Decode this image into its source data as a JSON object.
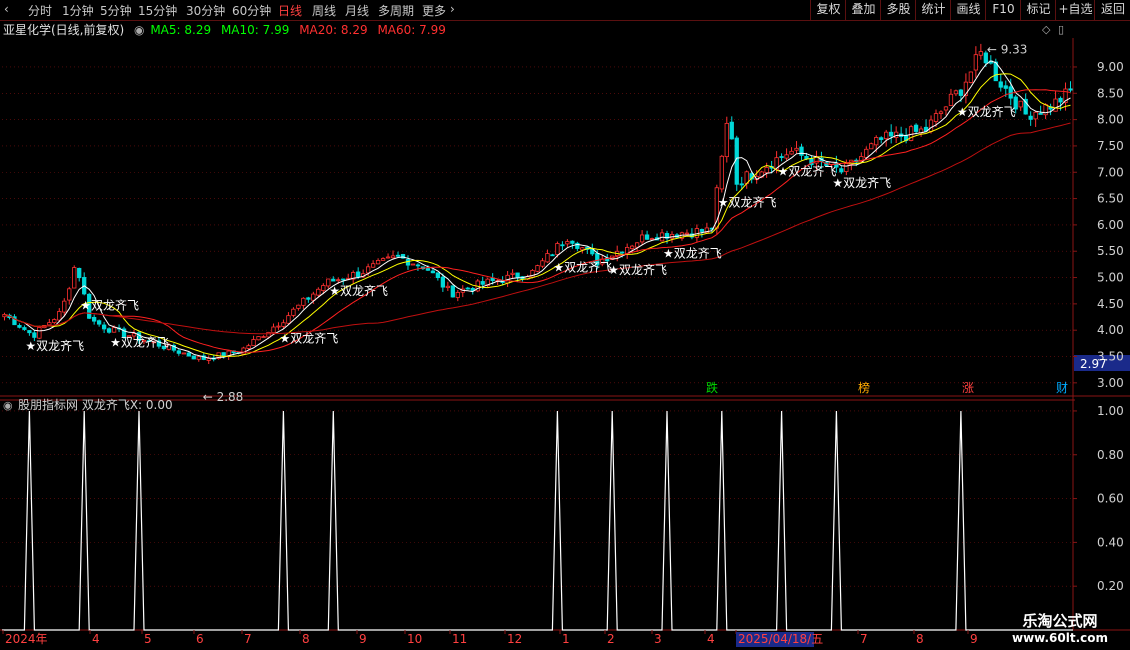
{
  "toolbar": {
    "timeframes": [
      "分时",
      "1分钟",
      "5分钟",
      "15分钟",
      "30分钟",
      "60分钟",
      "日线",
      "周线",
      "月线",
      "多周期",
      "更多"
    ],
    "active_timeframe": "日线",
    "right_buttons": [
      "复权",
      "叠加",
      "多股",
      "统计",
      "画线",
      "F10",
      "标记",
      "+自选",
      "返回"
    ]
  },
  "stock": {
    "title": "亚星化学(日线,前复权)"
  },
  "ma": {
    "ma5_label": "MA5: 8.29",
    "ma10_label": "MA10: 7.99",
    "ma20_label": "MA20: 8.29",
    "ma60_label": "MA60: 7.99"
  },
  "colors": {
    "up": "#ff3030",
    "down": "#00d8d8",
    "ma5": "#ffffff",
    "ma10": "#ffff00",
    "ma20": "#ff2020",
    "ma60": "#00ff00",
    "grid": "#7a1010",
    "signal": "#ffffff"
  },
  "indicator": {
    "title": "股朋指标网 双龙齐飞X: 0.00"
  },
  "signal_text": "★双龙齐飞",
  "price_panel": {
    "current_price": "2.97",
    "high_label": "9.33",
    "low_label": "2.88"
  },
  "event_tags": [
    "跌",
    "榜",
    "涨",
    "财"
  ],
  "watermark": {
    "title": "乐淘公式网",
    "url": "www.60lt.com"
  },
  "chart_data": [
    {
      "type": "candlestick",
      "title": "",
      "y_ticks": [
        9.0,
        8.5,
        8.0,
        7.5,
        7.0,
        6.5,
        6.0,
        5.5,
        5.0,
        4.5,
        4.0,
        3.5,
        3.0
      ],
      "ylim": [
        2.75,
        9.55
      ],
      "annotations": {
        "high": 9.33,
        "low": 2.88,
        "current": 2.97
      },
      "signal_indices": [
        5,
        16,
        22,
        56,
        66,
        111,
        122,
        133,
        144,
        156,
        167,
        192
      ]
    },
    {
      "type": "line",
      "title": "双龙齐飞X",
      "current_value": 0.0,
      "y_ticks": [
        1.0,
        0.8,
        0.6,
        0.4,
        0.2
      ],
      "ylim": [
        0,
        1.05
      ],
      "x_tick_labels": [
        "2024年",
        "4",
        "5",
        "6",
        "7",
        "8",
        "9",
        "10",
        "11",
        "12",
        "1",
        "2",
        "3",
        "4",
        "2025/04/18/五",
        "7",
        "8",
        "9"
      ],
      "spike_indices": [
        5,
        16,
        27,
        56,
        66,
        111,
        122,
        133,
        144,
        156,
        167,
        192
      ],
      "baseline": 0.0,
      "spike_value": 1.0
    }
  ]
}
